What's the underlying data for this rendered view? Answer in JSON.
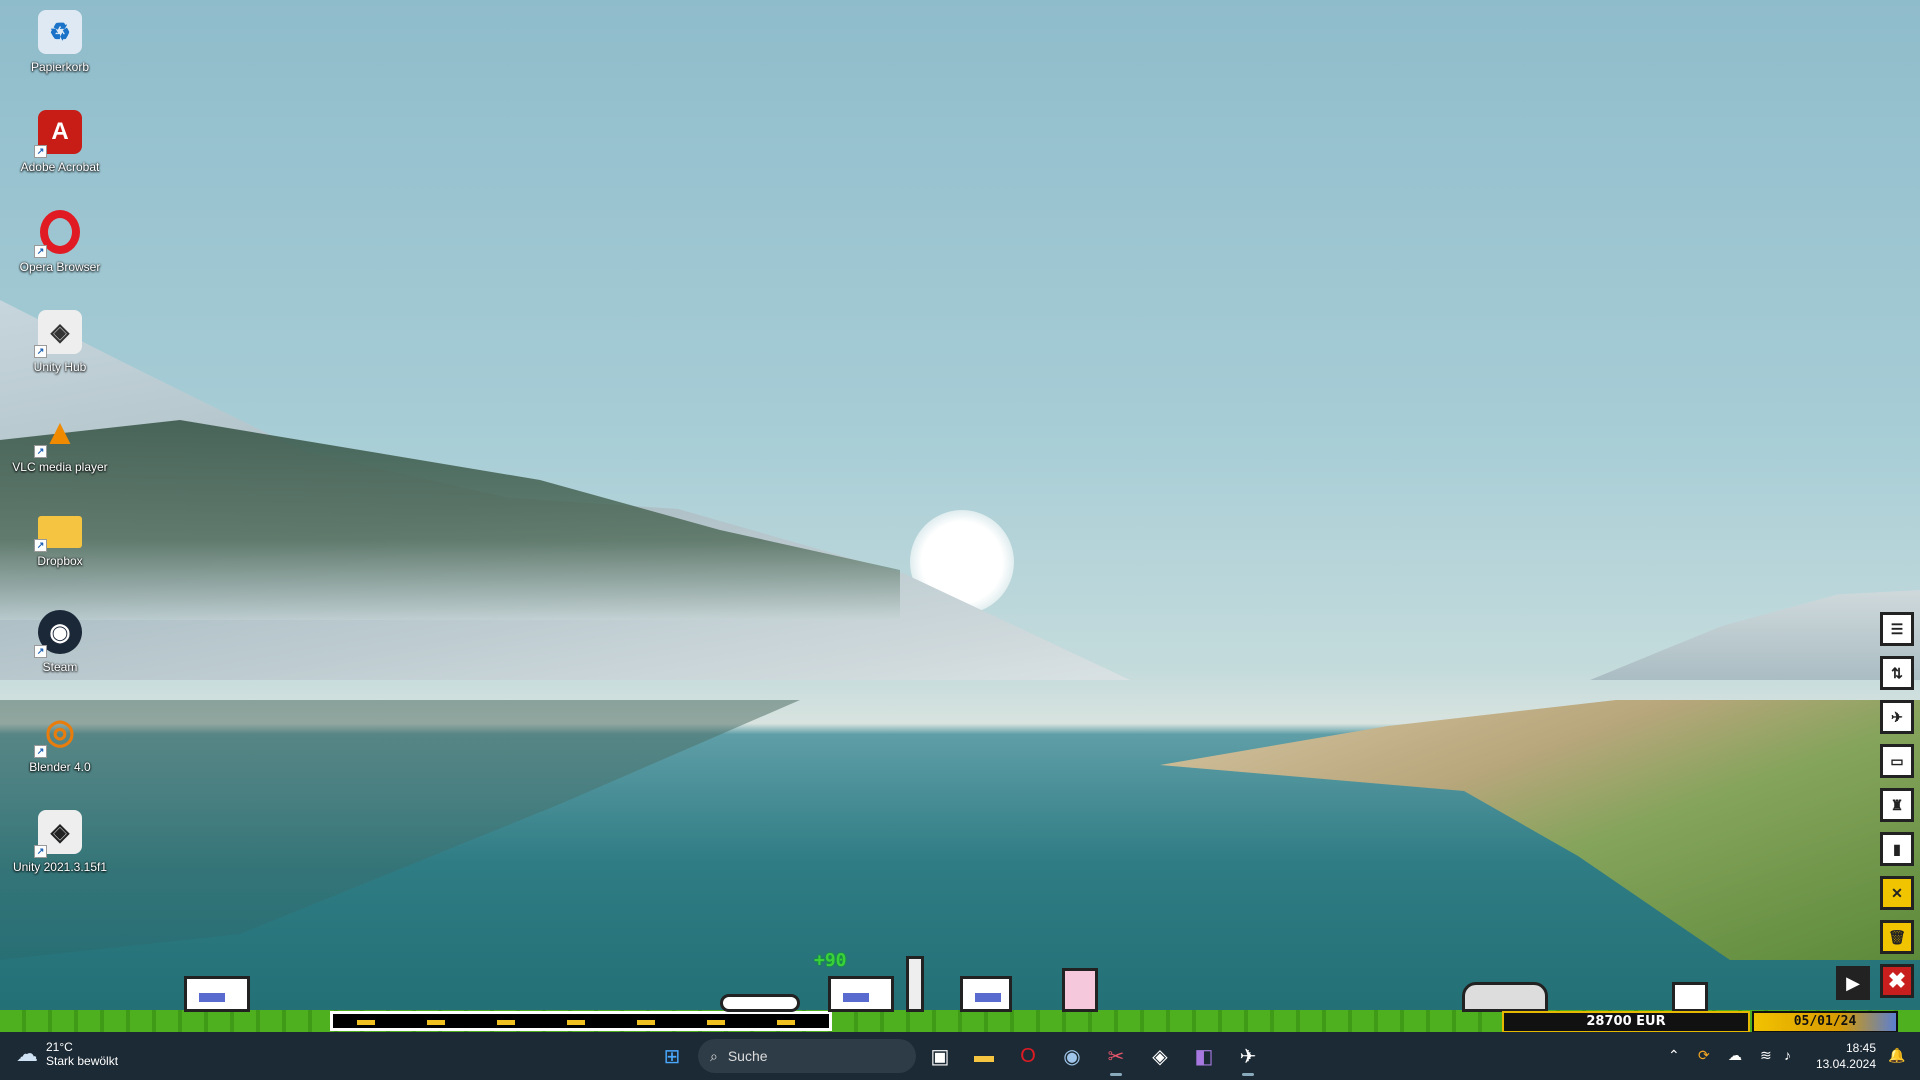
{
  "desktop": {
    "icons": [
      {
        "label": "Papierkorb",
        "glyph": "♻",
        "color": "#dfe9f3"
      },
      {
        "label": "Adobe Acrobat",
        "glyph": "A",
        "color": "#c81d17"
      },
      {
        "label": "Opera Browser",
        "glyph": "O",
        "color": "#e01b24"
      },
      {
        "label": "Unity Hub",
        "glyph": "◈",
        "color": "#333"
      },
      {
        "label": "VLC media player",
        "glyph": "▲",
        "color": "#f08a00"
      },
      {
        "label": "Dropbox",
        "glyph": "▭",
        "color": "#f5c542"
      },
      {
        "label": "Steam",
        "glyph": "◉",
        "color": "#1b2838"
      },
      {
        "label": "Blender 4.0",
        "glyph": "◎",
        "color": "#e87d0d"
      },
      {
        "label": "Unity 2021.3.15f1",
        "glyph": "◈",
        "color": "#222"
      }
    ]
  },
  "game": {
    "money": "28700 EUR",
    "date": "05/01/24",
    "bonus": "+90",
    "toolbar": [
      "list-icon",
      "sort-icon",
      "schedule-icon",
      "train-icon",
      "tower-icon",
      "gate-icon",
      "expand-icon",
      "trash-icon",
      "close-icon"
    ]
  },
  "taskbar": {
    "weather": {
      "temp": "21°C",
      "desc": "Stark bewölkt"
    },
    "search_placeholder": "Suche",
    "apps": [
      "task-view",
      "file-explorer",
      "opera",
      "steam",
      "snipping-tool",
      "unity",
      "visual-studio",
      "game"
    ],
    "time": "18:45",
    "date": "13.04.2024"
  }
}
